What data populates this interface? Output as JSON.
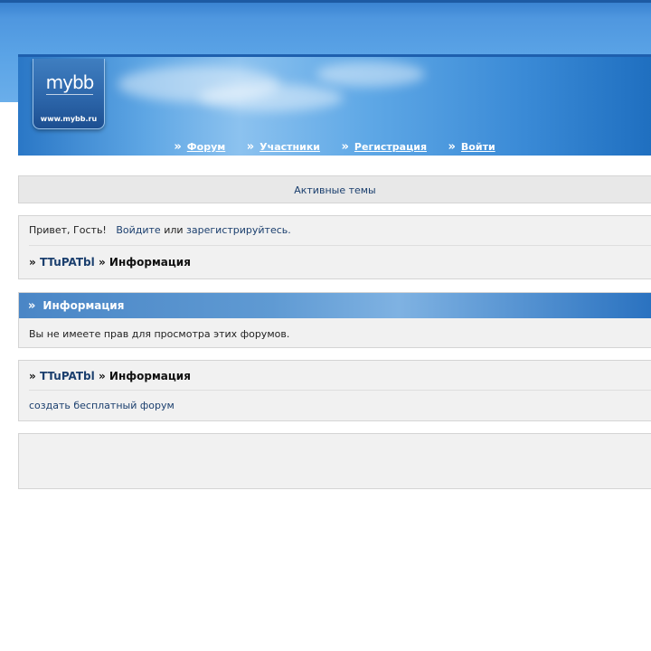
{
  "logo": {
    "mark": "mybb",
    "url": "www.mybb.ru"
  },
  "nav": {
    "items": [
      {
        "label": "Форум"
      },
      {
        "label": "Участники"
      },
      {
        "label": "Регистрация"
      },
      {
        "label": "Войти"
      }
    ]
  },
  "active_topics": {
    "label": "Активные темы"
  },
  "welcome": {
    "greeting": "Привет, Гость!",
    "login_link": "Войдите",
    "or_text": "или",
    "register_link": "зарегистрируйтесь."
  },
  "breadcrumb": {
    "separator": "»",
    "home": "TTuPATbl",
    "current": "Информация"
  },
  "info": {
    "title": "Информация",
    "message": "Вы не имеете прав для просмотра этих форумов."
  },
  "footer": {
    "create_link": "создать бесплатный форум"
  }
}
